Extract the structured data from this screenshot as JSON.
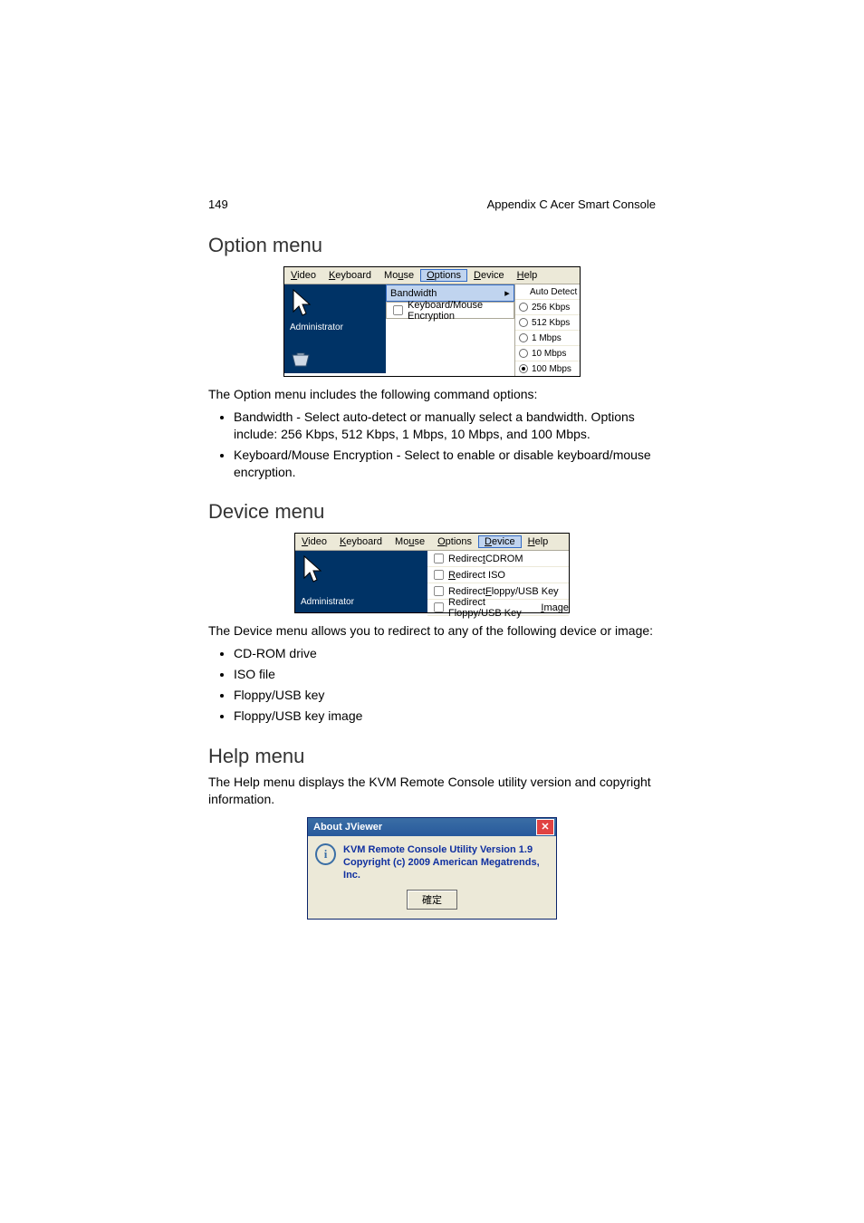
{
  "page_number": "149",
  "appendix_title": "Appendix C Acer Smart Console",
  "section_option": {
    "heading": "Option menu",
    "intro": "The Option menu includes the following command options:",
    "bullets": [
      "Bandwidth - Select auto-detect or manually select a bandwidth. Options include: 256 Kbps, 512 Kbps, 1 Mbps, 10 Mbps, and 100 Mbps.",
      "Keyboard/Mouse Encryption - Select to enable or disable keyboard/mouse encryption."
    ],
    "menubar": [
      "Video",
      "Keyboard",
      "Mouse",
      "Options",
      "Device",
      "Help"
    ],
    "selected_menu_index": 3,
    "admin_label": "Administrator",
    "dropdown": {
      "bandwidth_label": "Bandwidth",
      "kme_label": "Keyboard/Mouse Encryption",
      "kme_checked": false
    },
    "bandwidth_submenu": [
      {
        "label": "Auto Detect",
        "radio": "none",
        "selected": false
      },
      {
        "label": "256 Kbps",
        "radio": "off",
        "selected": false
      },
      {
        "label": "512 Kbps",
        "radio": "off",
        "selected": false
      },
      {
        "label": "1 Mbps",
        "radio": "off",
        "selected": false
      },
      {
        "label": "10 Mbps",
        "radio": "off",
        "selected": false
      },
      {
        "label": "100 Mbps",
        "radio": "on",
        "selected": false
      }
    ]
  },
  "section_device": {
    "heading": "Device menu",
    "intro": "The Device menu allows you to redirect to any of the following device or image:",
    "bullets": [
      "CD-ROM drive",
      "ISO file",
      "Floppy/USB key",
      "Floppy/USB key image"
    ],
    "menubar": [
      "Video",
      "Keyboard",
      "Mouse",
      "Options",
      "Device",
      "Help"
    ],
    "selected_menu_index": 4,
    "admin_label": "Administrator",
    "items": [
      {
        "label": "Redirect CDROM",
        "checked": false
      },
      {
        "label": "Redirect ISO",
        "checked": false
      },
      {
        "label": "Redirect Floppy/USB Key",
        "checked": false
      },
      {
        "label": "Redirect Floppy/USB Key Image",
        "checked": false
      }
    ]
  },
  "section_help": {
    "heading": "Help menu",
    "intro": "The Help menu displays the KVM Remote Console utility version and copyright information.",
    "dialog": {
      "title": "About JViewer",
      "line1": "KVM Remote Console Utility Version 1.9",
      "line2": "Copyright (c) 2009 American Megatrends, Inc.",
      "button": "確定"
    }
  }
}
